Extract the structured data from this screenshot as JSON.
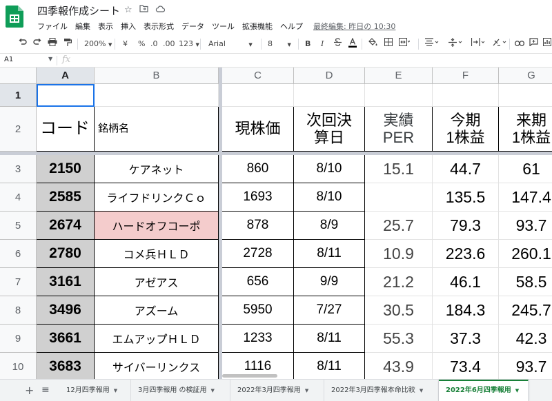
{
  "title": "四季報作成シート",
  "menu": [
    "ファイル",
    "編集",
    "表示",
    "挿入",
    "表示形式",
    "データ",
    "ツール",
    "拡張機能",
    "ヘルプ"
  ],
  "last_edit": "最終編集: 昨日の 10:30",
  "toolbar": {
    "zoom": "200%",
    "currency": "¥",
    "percent": "%",
    "dec_decrease": ".0",
    "dec_increase": ".00",
    "format_more": "123",
    "font": "Arial",
    "font_size": "8",
    "bold": "B",
    "italic": "I"
  },
  "namebox": "A1",
  "fx": "fx",
  "columns": [
    "A",
    "B",
    "C",
    "D",
    "E",
    "F",
    "G"
  ],
  "rows": [
    {
      "num": "1",
      "cells": [
        "",
        "",
        "",
        "",
        "",
        "",
        ""
      ]
    },
    {
      "num": "2",
      "cells": [
        "コード",
        "銘柄名",
        "現株価",
        "次回決\n算日",
        "実績\nPER",
        "今期\n1株益",
        "来期\n1株益"
      ]
    },
    {
      "num": "3",
      "cells": [
        "2150",
        "ケアネット",
        "860",
        "8/10",
        "15.1",
        "44.7",
        "61"
      ]
    },
    {
      "num": "4",
      "cells": [
        "2585",
        "ライフドリンクＣｏ",
        "1693",
        "8/10",
        "",
        "135.5",
        "147.4"
      ]
    },
    {
      "num": "5",
      "cells": [
        "2674",
        "ハードオフコーポ",
        "878",
        "8/9",
        "25.7",
        "79.3",
        "93.7"
      ]
    },
    {
      "num": "6",
      "cells": [
        "2780",
        "コメ兵ＨＬＤ",
        "2728",
        "8/11",
        "10.9",
        "223.6",
        "260.1"
      ]
    },
    {
      "num": "7",
      "cells": [
        "3161",
        "アゼアス",
        "656",
        "9/9",
        "21.2",
        "46.1",
        "58.5"
      ]
    },
    {
      "num": "8",
      "cells": [
        "3496",
        "アズーム",
        "5950",
        "7/27",
        "30.5",
        "184.3",
        "245.7"
      ]
    },
    {
      "num": "9",
      "cells": [
        "3661",
        "エムアップＨＬＤ",
        "1233",
        "8/11",
        "55.3",
        "37.3",
        "42.3"
      ]
    },
    {
      "num": "10",
      "cells": [
        "3683",
        "サイバーリンクス",
        "1116",
        "8/11",
        "43.9",
        "73.4",
        "93.7"
      ]
    }
  ],
  "sheets": [
    {
      "label": "12月四季報用",
      "active": false
    },
    {
      "label": "3月四季報用 の検証用",
      "active": false
    },
    {
      "label": "2022年3月四季報用",
      "active": false
    },
    {
      "label": "2022年3月四季報本命比較",
      "active": false
    },
    {
      "label": "2022年6月四季報用",
      "active": true
    }
  ],
  "colors": {
    "accent_green": "#188038",
    "selection_blue": "#1a73e8",
    "code_cell_bg": "#d0d0d0",
    "highlight_pink": "#f4cccc"
  }
}
